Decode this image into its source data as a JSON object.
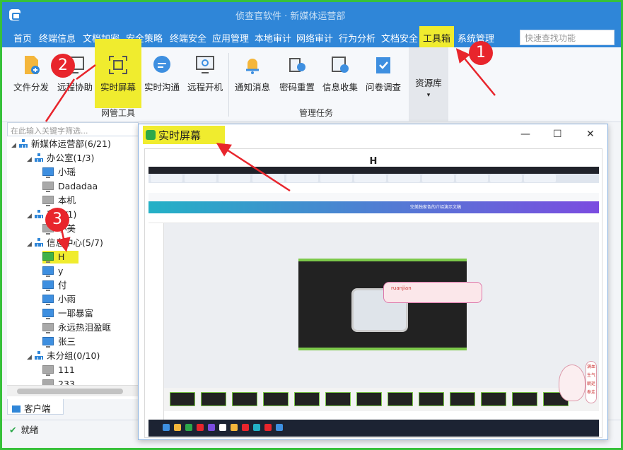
{
  "window": {
    "title": "侦查官软件 · 新媒体运营部"
  },
  "menu": {
    "items": [
      "首页",
      "终端信息",
      "文档加密",
      "安全策略",
      "终端安全",
      "应用管理",
      "本地审计",
      "网络审计",
      "行为分析",
      "文档安全",
      "工具箱",
      "系统管理"
    ],
    "active_index": 10,
    "search_placeholder": "快速查找功能"
  },
  "ribbon": {
    "tools_net": [
      "文件分发",
      "远程协助",
      "实时屏幕",
      "实时沟通",
      "远程开机"
    ],
    "tools_task": [
      "通知消息",
      "密码重置",
      "信息收集",
      "问卷调查"
    ],
    "group_net": "网管工具",
    "group_task": "管理任务",
    "resource_lib": "资源库"
  },
  "tree": {
    "filter_placeholder": "在此输入关键字筛选...",
    "nodes": [
      {
        "label": "新媒体运营部(6/21)",
        "kind": "group",
        "level": 0
      },
      {
        "label": "办公室(1/3)",
        "kind": "group",
        "level": 1
      },
      {
        "label": "小瑶",
        "kind": "pc",
        "state": "online",
        "level": 2
      },
      {
        "label": "Dadadaa",
        "kind": "pc",
        "state": "offline",
        "level": 2
      },
      {
        "label": "本机",
        "kind": "pc",
        "state": "offline",
        "level": 2
      },
      {
        "label": "部(0/1)",
        "kind": "group",
        "level": 1
      },
      {
        "label": "小美",
        "kind": "pc",
        "state": "offline",
        "level": 2
      },
      {
        "label": "信息中心(5/7)",
        "kind": "group",
        "level": 1
      },
      {
        "label": "H",
        "kind": "pc",
        "state": "selected",
        "level": 2
      },
      {
        "label": "y",
        "kind": "pc",
        "state": "online",
        "level": 2
      },
      {
        "label": "付",
        "kind": "pc",
        "state": "online",
        "level": 2
      },
      {
        "label": "小雨",
        "kind": "pc",
        "state": "online",
        "level": 2
      },
      {
        "label": "一耶暴富",
        "kind": "pc",
        "state": "online",
        "level": 2
      },
      {
        "label": "永远热泪盈眶",
        "kind": "pc",
        "state": "offline",
        "level": 2
      },
      {
        "label": "张三",
        "kind": "pc",
        "state": "online",
        "level": 2
      },
      {
        "label": "未分组(0/10)",
        "kind": "group",
        "level": 1
      },
      {
        "label": "111",
        "kind": "pc",
        "state": "offline",
        "level": 2
      },
      {
        "label": "233",
        "kind": "pc",
        "state": "offline",
        "level": 2
      }
    ]
  },
  "client_tab": "客户端",
  "status": "就绪",
  "realtime_window": {
    "title": "实时屏幕",
    "host": "H",
    "screen": {
      "canva_title": "完美独家色的介绍演示文稿",
      "popup_text": "ruanjian",
      "mascot_text": "满血生气朝廷奉走"
    }
  },
  "callouts": [
    "1",
    "2",
    "3"
  ],
  "colors": {
    "brand": "#2f86d8",
    "highlight": "#f0ec2e",
    "callout": "#e8252c",
    "frame": "#37c13a"
  }
}
